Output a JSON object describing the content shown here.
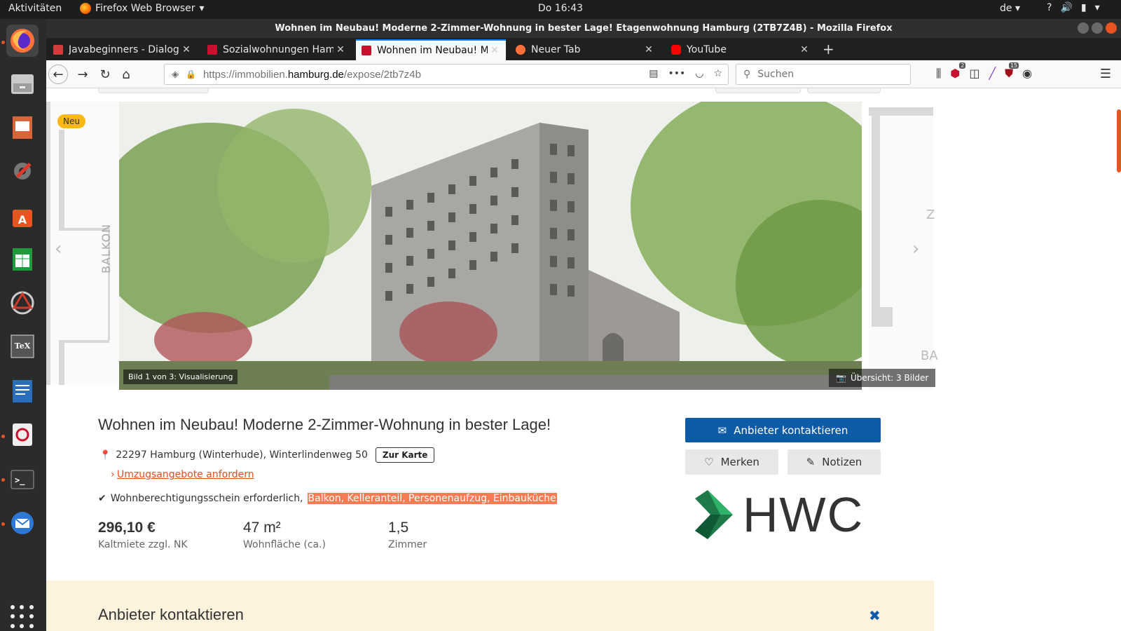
{
  "system": {
    "activities": "Aktivitäten",
    "app_menu": "Firefox Web Browser",
    "clock": "Do 16:43",
    "language": "de"
  },
  "window": {
    "title": "Wohnen im Neubau! Moderne 2-Zimmer-Wohnung in bester Lage! Etagenwohnung Hamburg (2TB7Z4B) - Mozilla Firefox"
  },
  "tabs": [
    {
      "label": "Javabeginners - Dialoge",
      "favicon_color": "#d13c3c"
    },
    {
      "label": "Sozialwohnungen Hamburg",
      "favicon_color": "#c8102e"
    },
    {
      "label": "Wohnen im Neubau! Moderne",
      "favicon_color": "#c8102e",
      "active": true
    },
    {
      "label": "Neuer Tab",
      "favicon_color": "#ff7139"
    },
    {
      "label": "YouTube",
      "favicon_color": "#ff0000"
    }
  ],
  "navbar": {
    "url_prefix": "https://immobilien.",
    "url_domain": "hamburg.de",
    "url_path": "/expose/2tb7z4b",
    "search_placeholder": "Suchen",
    "abp_badge": "2",
    "ublock_badge": "15"
  },
  "gallery": {
    "new_badge": "Neu",
    "floorplan_label": "BALKON",
    "caption": "Bild 1 von 3: Visualisierung",
    "overview": "Übersicht: 3 Bilder",
    "right_plan_z": "Z",
    "right_plan_ba": "BA"
  },
  "listing": {
    "title": "Wohnen im Neubau! Moderne 2-Zimmer-Wohnung in bester Lage!",
    "address": "22297 Hamburg (Winterhude), Winterlindenweg 50",
    "map_button": "Zur Karte",
    "moving_offers": "Umzugsangebote anfordern",
    "requirements": "Wohnberechtigungsschein erforderlich,",
    "features": "Balkon, Kelleranteil, Personenaufzug, Einbauküche",
    "rent_value": "296,10 €",
    "rent_label": "Kaltmiete zzgl. NK",
    "area_value": "47 m²",
    "area_label": "Wohnfläche (ca.)",
    "rooms_value": "1,5",
    "rooms_label": "Zimmer"
  },
  "actions": {
    "contact": "Anbieter kontaktieren",
    "remember": "Merken",
    "notes": "Notizen"
  },
  "provider": {
    "logo_text": "HWC"
  },
  "contact_panel": {
    "title": "Anbieter kontaktieren"
  },
  "colors": {
    "primary_blue": "#0d5aa7",
    "accent_orange": "#e04e1f",
    "highlight": "#f47b52",
    "badge_yellow": "#fdb913",
    "panel_bg": "#fdf3dc"
  }
}
